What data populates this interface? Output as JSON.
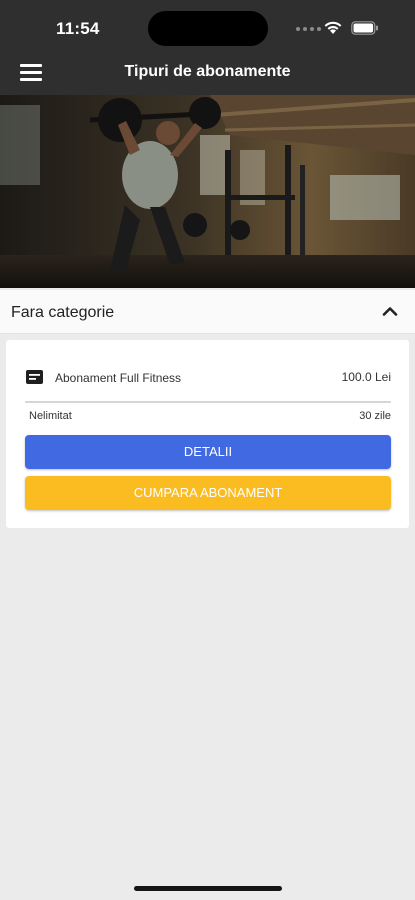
{
  "status_bar": {
    "time": "11:54"
  },
  "header": {
    "title": "Tipuri de abonamente",
    "menu_icon": "hamburger-menu-icon"
  },
  "hero": {
    "alt": "gym-photo"
  },
  "category": {
    "title": "Fara categorie",
    "toggle_icon": "chevron-up-icon"
  },
  "subscription": {
    "icon": "card-icon",
    "name": "Abonament Full Fitness",
    "price": "100.0 Lei",
    "access": "Nelimitat",
    "duration": "30 zile",
    "details_label": "DETALII",
    "buy_label": "CUMPARA ABONAMENT"
  },
  "colors": {
    "header_bg": "#2f2f2f",
    "details_button": "#4169e1",
    "buy_button": "#fbbc21",
    "page_bg": "#ebebeb"
  }
}
